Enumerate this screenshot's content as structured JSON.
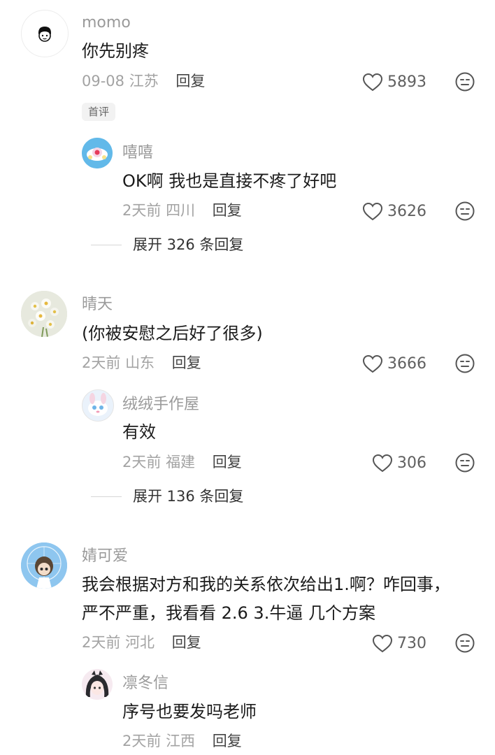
{
  "comments": [
    {
      "user": "momo",
      "text": "你先别疼",
      "date": "09-08",
      "location": "江苏",
      "reply_label": "回复",
      "likes": "5893",
      "badge": "首评",
      "avatar_icon": "cartoon-face-avatar",
      "replies": [
        {
          "user": "嘻嘻",
          "text": "OK啊 我也是直接不疼了好吧",
          "date": "2天前",
          "location": "四川",
          "reply_label": "回复",
          "likes": "3626",
          "avatar_icon": "blue-flower-avatar"
        }
      ],
      "expand_label": "展开 326 条回复"
    },
    {
      "user": "晴天",
      "text": "(你被安慰之后好了很多)",
      "date": "2天前",
      "location": "山东",
      "reply_label": "回复",
      "likes": "3666",
      "avatar_icon": "daisy-bouquet-avatar",
      "replies": [
        {
          "user": "绒绒手作屋",
          "text": "有效",
          "date": "2天前",
          "location": "福建",
          "reply_label": "回复",
          "likes": "306",
          "avatar_icon": "cute-bunny-avatar"
        }
      ],
      "expand_label": "展开 136 条回复"
    },
    {
      "user": "婧可爱",
      "text_lines": [
        "我会根据对方和我的关系依次给出1.啊？咋回事，",
        "严不严重，我看看 2.6  3.牛逼  几个方案"
      ],
      "date": "2天前",
      "location": "河北",
      "reply_label": "回复",
      "likes": "730",
      "avatar_icon": "doll-ferris-wheel-avatar",
      "replies": [
        {
          "user": "凛冬信",
          "text": "序号也要发吗老师",
          "date": "2天前",
          "location": "江西",
          "reply_label": "回复",
          "avatar_icon": "anime-girl-avatar"
        }
      ]
    }
  ]
}
